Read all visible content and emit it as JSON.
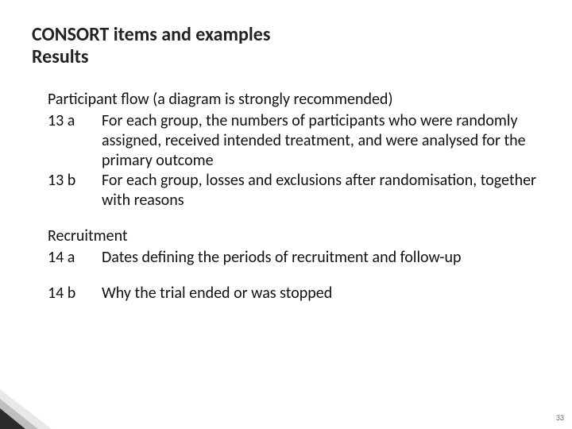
{
  "title": {
    "line1": "CONSORT items and examples",
    "line2": "Results"
  },
  "sections": [
    {
      "heading": "Participant flow (a diagram is strongly recommended)",
      "items": [
        {
          "num": "13 a",
          "text": "For each group, the numbers of participants who were randomly assigned, received intended treatment, and were analysed for the primary outcome"
        },
        {
          "num": "13 b",
          "text": "For each group, losses and exclusions after randomisation, together with reasons"
        }
      ]
    },
    {
      "heading": "Recruitment",
      "items": [
        {
          "num": "14 a",
          "text": "Dates defining the periods of recruitment and follow-up"
        },
        {
          "num": "14 b",
          "text": "Why the trial ended or was stopped"
        }
      ]
    }
  ],
  "page_number": "33"
}
